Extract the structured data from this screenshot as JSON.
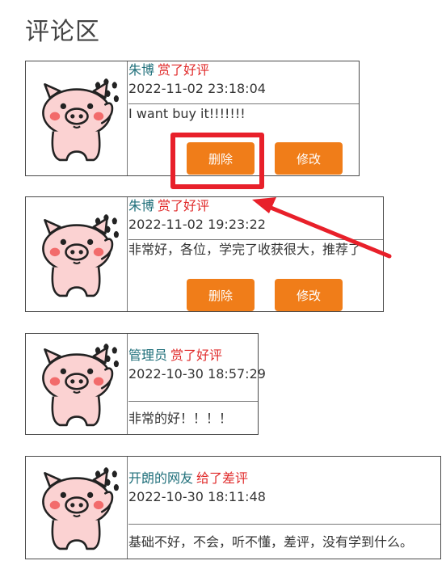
{
  "page": {
    "title": "评论区"
  },
  "comments": [
    {
      "user": "朱博",
      "rating": "赏了好评",
      "time": "2022-11-02 23:18:04",
      "content": "I want buy it!!!!!!!",
      "delete_label": "删除",
      "edit_label": "修改"
    },
    {
      "user": "朱博",
      "rating": "赏了好评",
      "time": "2022-11-02 19:23:22",
      "content": "非常好，各位，学完了收获很大，推荐了",
      "delete_label": "删除",
      "edit_label": "修改"
    },
    {
      "user": "管理员",
      "rating": "赏了好评",
      "time": "2022-10-30 18:57:29",
      "content": "非常的好！！！！"
    },
    {
      "user": "开朗的网友",
      "rating": "给了差评",
      "time": "2022-10-30 18:11:48",
      "content": "基础不好，不会，听不懂，差评，没有学到什么。"
    }
  ],
  "colors": {
    "username": "#1f6f7a",
    "rating": "#e02b2b",
    "button": "#f07d19",
    "annotation": "#e8202a"
  }
}
